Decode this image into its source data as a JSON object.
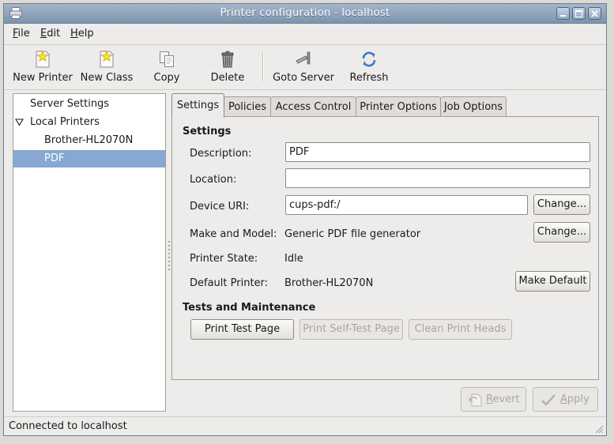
{
  "window": {
    "title": "Printer configuration - localhost",
    "controls": [
      "minimize-icon",
      "maximize-icon",
      "close-icon"
    ]
  },
  "menubar": {
    "file": {
      "mnemonic": "F",
      "rest": "ile"
    },
    "edit": {
      "mnemonic": "E",
      "rest": "dit"
    },
    "help": {
      "mnemonic": "H",
      "rest": "elp"
    }
  },
  "toolbar": {
    "new_printer": {
      "label": "New Printer",
      "icon": "new-printer-icon"
    },
    "new_class": {
      "label": "New Class",
      "icon": "new-class-icon"
    },
    "copy": {
      "label": "Copy",
      "icon": "copy-icon"
    },
    "delete": {
      "label": "Delete",
      "icon": "delete-icon"
    },
    "goto_server": {
      "label": "Goto Server",
      "icon": "goto-server-icon"
    },
    "refresh": {
      "label": "Refresh",
      "icon": "refresh-icon"
    }
  },
  "tree": {
    "server_settings": "Server Settings",
    "local_printers": "Local Printers",
    "printers": [
      "Brother-HL2070N",
      "PDF"
    ],
    "selected": "PDF"
  },
  "tabs": [
    "Settings",
    "Policies",
    "Access Control",
    "Printer Options",
    "Job Options"
  ],
  "active_tab": "Settings",
  "settings": {
    "heading": "Settings",
    "description_label": "Description:",
    "description_value": "PDF",
    "location_label": "Location:",
    "location_value": "",
    "device_uri_label": "Device URI:",
    "device_uri_value": "cups-pdf:/",
    "change_label": "Change...",
    "make_model_label": "Make and Model:",
    "make_model_value": "Generic PDF file generator",
    "printer_state_label": "Printer State:",
    "printer_state_value": "Idle",
    "default_printer_label": "Default Printer:",
    "default_printer_value": "Brother-HL2070N",
    "make_default_label": "Make Default"
  },
  "tests": {
    "heading": "Tests and Maintenance",
    "print_test_page": "Print Test Page",
    "print_self_test_page": "Print Self-Test Page",
    "clean_print_heads": "Clean Print Heads"
  },
  "actions": {
    "revert_mnemonic": "R",
    "revert_rest": "evert",
    "apply_mnemonic": "A",
    "apply_rest": "pply"
  },
  "status": "Connected to localhost",
  "colors": {
    "titlebar": "#8fa3bd",
    "selection": "#86a8d3",
    "window_bg": "#edeceb"
  }
}
